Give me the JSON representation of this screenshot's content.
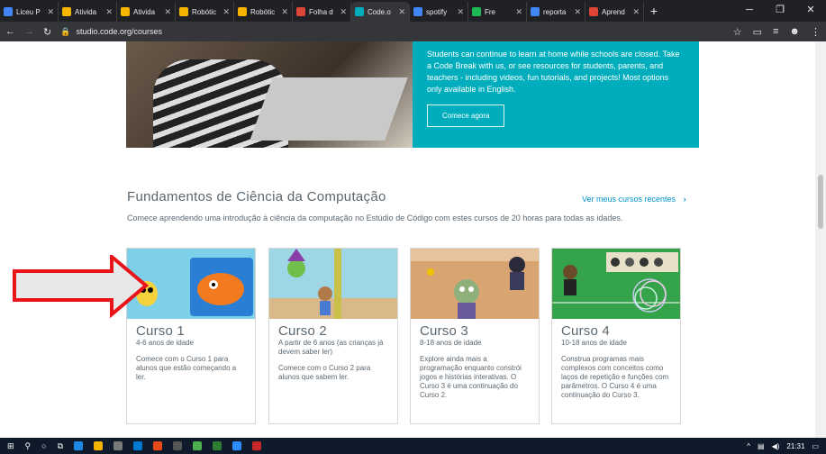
{
  "browser": {
    "tabs": [
      {
        "label": "Liceu P",
        "color": "#4285f4",
        "active": false
      },
      {
        "label": "Ativida",
        "color": "#f4b400",
        "active": false
      },
      {
        "label": "Ativida",
        "color": "#f4b400",
        "active": false
      },
      {
        "label": "Robótic",
        "color": "#f4b400",
        "active": false
      },
      {
        "label": "Robótic",
        "color": "#f4b400",
        "active": false
      },
      {
        "label": "Folha d",
        "color": "#db4437",
        "active": false
      },
      {
        "label": "Code.o",
        "color": "#00adbc",
        "active": true
      },
      {
        "label": "spotify",
        "color": "#4285f4",
        "active": false
      },
      {
        "label": "Fre",
        "color": "#1db954",
        "active": false
      },
      {
        "label": "reporta",
        "color": "#4285f4",
        "active": false
      },
      {
        "label": "Aprend",
        "color": "#db4437",
        "active": false
      }
    ],
    "url": "studio.code.org/courses"
  },
  "hero": {
    "text": "Students can continue to learn at home while schools are closed. Take a Code Break with us, or see resources for students, parents, and teachers - including videos, fun tutorials, and projects! Most options only available in English.",
    "button": "Comece agora"
  },
  "section": {
    "title": "Fundamentos de Ciência da Computação",
    "link": "Ver meus cursos recentes",
    "subtitle": "Comece aprendendo uma introdução à ciência da computação no Estúdio de Código com estes cursos de 20 horas para todas as idades."
  },
  "courses": [
    {
      "title": "Curso 1",
      "age": "4-6 anos de idade",
      "desc": "Comece com o Curso 1 para alunos que estão começando a ler."
    },
    {
      "title": "Curso 2",
      "age": "A partir de 6 anos (as crianças já devem saber ler)",
      "desc": "Comece com o Curso 2 para alunos que sabem ler."
    },
    {
      "title": "Curso 3",
      "age": "8-18 anos de idade",
      "desc": "Explore ainda mais a programação enquanto constrói jogos e histórias interativas. O Curso 3 é uma continuação do Curso 2."
    },
    {
      "title": "Curso 4",
      "age": "10-18 anos de idade",
      "desc": "Construa programas mais complexos com conceitos como laços de repetição e funções com parâmetros. O Curso 4 é uma continuação do Curso 3."
    }
  ],
  "taskbar": {
    "time": "21:31"
  },
  "colors": {
    "accent": "#00adbc",
    "link": "#0094ca",
    "arrow": "#e8141a"
  }
}
